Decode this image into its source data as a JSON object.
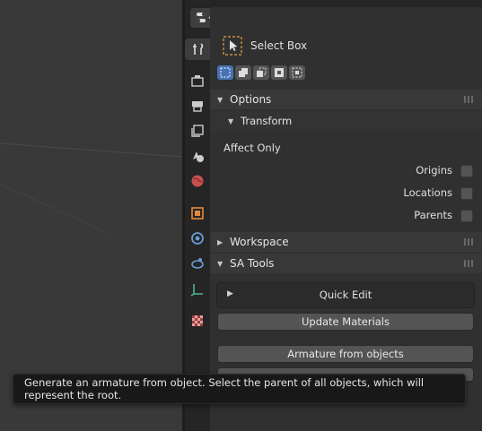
{
  "tool": {
    "name": "Select Box",
    "icon": "select-box-cursor-icon"
  },
  "mode_buttons": [
    {
      "icon": "mode-new-icon",
      "active": true
    },
    {
      "icon": "mode-extend-icon",
      "active": false
    },
    {
      "icon": "mode-subtract-icon",
      "active": false
    },
    {
      "icon": "mode-invert-icon",
      "active": false
    },
    {
      "icon": "mode-intersect-icon",
      "active": false
    }
  ],
  "tabs": [
    {
      "icon": "tool-icon",
      "active": true
    },
    {
      "icon": "render-icon"
    },
    {
      "icon": "output-icon"
    },
    {
      "icon": "view-layer-icon"
    },
    {
      "icon": "scene-icon"
    },
    {
      "icon": "world-icon"
    },
    {
      "icon": "object-icon"
    },
    {
      "icon": "modifier-icon"
    },
    {
      "icon": "particles-icon"
    },
    {
      "icon": "physics-icon"
    },
    {
      "icon": "texture-icon"
    }
  ],
  "sections": {
    "options": "Options",
    "transform": "Transform",
    "affect_only": "Affect Only",
    "origins": "Origins",
    "locations": "Locations",
    "parents": "Parents",
    "workspace": "Workspace",
    "sa_tools": "SA Tools"
  },
  "buttons": {
    "quick_edit": "Quick Edit",
    "update_materials": "Update Materials",
    "armature_from_objects": "Armature from objects"
  },
  "tooltip": "Generate an armature from object. Select the parent of all objects, which will represent the root.",
  "colors": {
    "accent": "#4772b3",
    "panel": "#303030",
    "header": "#383838"
  }
}
